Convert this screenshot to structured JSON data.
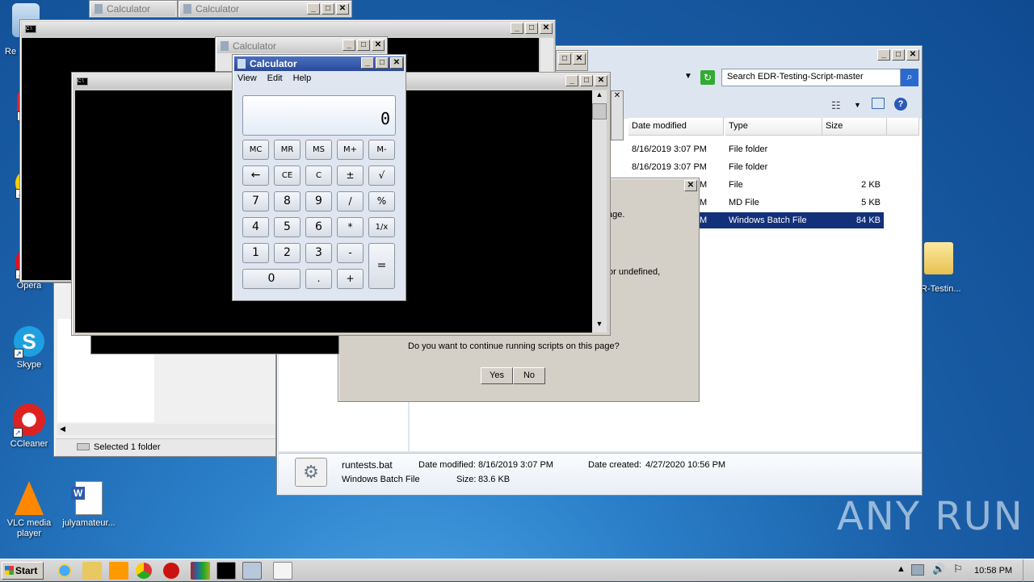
{
  "desktop": {
    "icons": [
      {
        "label": "Re",
        "name": "recycle-bin"
      },
      {
        "label": "Opera",
        "name": "opera"
      },
      {
        "label": "Skype",
        "name": "skype"
      },
      {
        "label": "CCleaner",
        "name": "ccleaner"
      },
      {
        "label": "VLC media player",
        "name": "vlc"
      },
      {
        "label": "julyamateur...",
        "name": "word-doc"
      },
      {
        "label": "R-Testin...",
        "name": "folder"
      }
    ],
    "watermark": "ANY RUN"
  },
  "windows": {
    "calc_title": "Calculator",
    "calc_title_2": "Calculator",
    "calc_title_3": "Calculator",
    "calc_title_main": "Calculator",
    "calc_menu": [
      "View",
      "Edit",
      "Help"
    ],
    "calc_display": "0",
    "calc_buttons": {
      "mc": "MC",
      "mr": "MR",
      "ms": "MS",
      "mplus": "M+",
      "mminus": "M-",
      "back": "←",
      "ce": "CE",
      "c": "C",
      "pm": "±",
      "sqrt": "√",
      "n7": "7",
      "n8": "8",
      "n9": "9",
      "div": "/",
      "pct": "%",
      "n4": "4",
      "n5": "5",
      "n6": "6",
      "mul": "*",
      "inv": "1/x",
      "n1": "1",
      "n2": "2",
      "n3": "3",
      "sub": "-",
      "eq": "=",
      "n0": "0",
      "dot": ".",
      "add": "+"
    }
  },
  "explorer": {
    "search_placeholder": "Search EDR-Testing-Script-master",
    "columns": [
      "Date modified",
      "Type",
      "Size"
    ],
    "rows": [
      {
        "date": "8/16/2019 3:07 PM",
        "type": "File folder",
        "size": ""
      },
      {
        "date": "8/16/2019 3:07 PM",
        "type": "File folder",
        "size": ""
      },
      {
        "date": "M",
        "type": "File",
        "size": "2 KB"
      },
      {
        "date": "M",
        "type": "MD File",
        "size": "5 KB"
      },
      {
        "date": "M",
        "type": "Windows Batch File",
        "size": "84 KB"
      }
    ],
    "details": {
      "filename": "runtests.bat",
      "filetype": "Windows Batch File",
      "modified_label": "Date modified:",
      "modified": "8/16/2019 3:07 PM",
      "created_label": "Date created:",
      "created": "4/27/2020 10:56 PM",
      "size_label": "Size:",
      "size": "83.6 KB"
    },
    "status_text": "Selected 1 folder"
  },
  "dialog": {
    "fragment_1": "age.",
    "fragment_2": "or undefined,",
    "question": "Do you want to continue running scripts on this page?",
    "yes": "Yes",
    "no": "No"
  },
  "taskbar": {
    "start": "Start",
    "clock": "10:58 PM"
  }
}
